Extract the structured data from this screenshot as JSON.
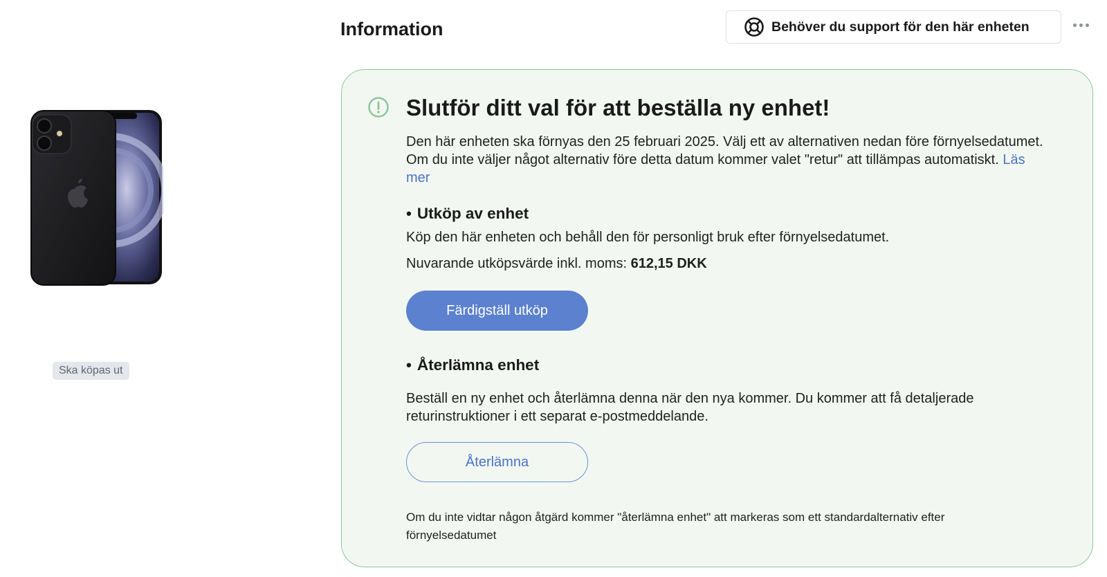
{
  "device": {
    "image_label": "phone-image",
    "status_badge": "Ska köpas ut"
  },
  "header": {
    "title": "Information",
    "support_button_label": "Behöver du support för den här enheten"
  },
  "info_card": {
    "title": "Slutför ditt val för att beställa ny enhet!",
    "intro_text": "Den här enheten ska förnyas den 25 februari 2025. Välj ett av alternativen nedan före förnyelsedatumet. Om du inte väljer något alternativ före detta datum kommer valet \"retur\" att tillämpas automatiskt.",
    "read_more_link": "Läs mer",
    "buyout": {
      "heading": "Utköp av enhet",
      "description": "Köp den här enheten och behåll den för personligt bruk efter förnyelsedatumet.",
      "value_label": "Nuvarande utköpsvärde inkl. moms:",
      "value_amount": "612,15 DKK",
      "button_label": "Färdigställ utköp"
    },
    "return": {
      "heading": "Återlämna enhet",
      "description": "Beställ en ny enhet och återlämna denna när den nya kommer. Du kommer att få detaljerade returinstruktioner i ett separat e-postmeddelande.",
      "button_label": "Återlämna"
    },
    "default_note": "Om du inte vidtar någon åtgärd kommer \"återlämna enhet\" att markeras som ett standardalternativ efter förnyelsedatumet"
  },
  "colors": {
    "card_background": "#f2f8f1",
    "card_border": "#8fc49a",
    "alert_icon": "#8fc49a",
    "primary_button": "#5b81cf",
    "link": "#4a72c9",
    "badge_background": "#e4e7eb"
  },
  "icons": {
    "support": "lifebuoy-icon",
    "alert": "exclamation-circle-icon",
    "more": "more-horizontal-icon"
  }
}
